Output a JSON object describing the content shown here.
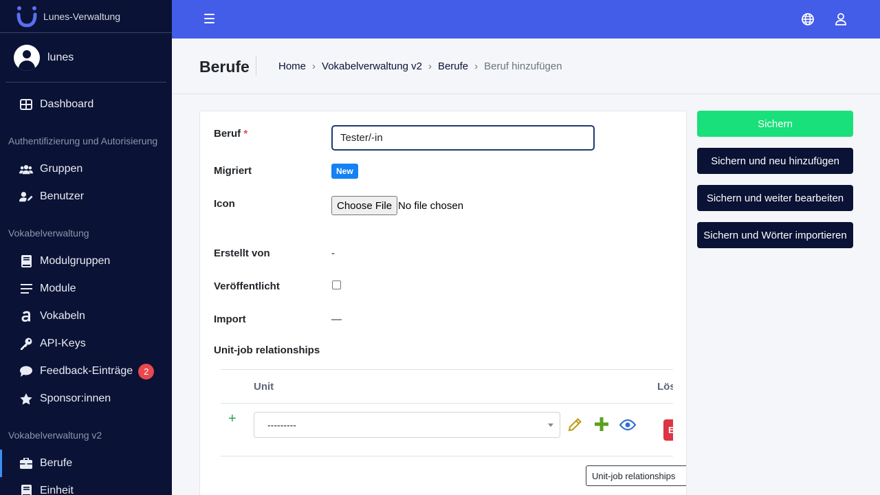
{
  "brand": {
    "name": "Lunes-Verwaltung"
  },
  "user": {
    "name": "lunes"
  },
  "sidebar": {
    "dashboard": "Dashboard",
    "sections": [
      {
        "header": "Authentifizierung und Autorisierung",
        "items": [
          "Gruppen",
          "Benutzer"
        ]
      },
      {
        "header": "Vokabelverwaltung",
        "items": [
          "Modulgruppen",
          "Module",
          "Vokabeln",
          "API-Keys",
          "Feedback-Einträge",
          "Sponsor:innen"
        ]
      },
      {
        "header": "Vokabelverwaltung v2",
        "items": [
          "Berufe",
          "Einheit"
        ]
      }
    ],
    "feedback_badge": "2",
    "active_item": "Berufe"
  },
  "header": {
    "page_title": "Berufe",
    "breadcrumb": [
      "Home",
      "Vokabelverwaltung v2",
      "Berufe",
      "Beruf hinzufügen"
    ]
  },
  "form": {
    "beruf": {
      "label": "Beruf",
      "required_mark": "*",
      "value": "Tester/-in"
    },
    "migriert": {
      "label": "Migriert",
      "badge": "New"
    },
    "icon": {
      "label": "Icon",
      "button": "Choose File",
      "status": "No file chosen"
    },
    "erstellt_von": {
      "label": "Erstellt von",
      "value": "-"
    },
    "veroeffentlicht": {
      "label": "Veröffentlicht",
      "checked": false
    },
    "import": {
      "label": "Import",
      "value": "—"
    },
    "relationships": {
      "label": "Unit-job relationships",
      "columns": {
        "unit": "Unit",
        "delete": "Lös"
      },
      "row": {
        "add": "+",
        "select_value": "---------",
        "delete_button": "E"
      },
      "add_button": "Unit-job relationships"
    }
  },
  "actions": {
    "save": "Sichern",
    "save_add": "Sichern und neu hinzufügen",
    "save_continue": "Sichern und weiter bearbeiten",
    "save_import": "Sichern und Wörter importieren"
  },
  "colors": {
    "sidebar_bg": "#0a1235",
    "topbar_bg": "#435de9",
    "success": "#19e07a",
    "danger": "#dc3545",
    "badge_blue": "#1482f4"
  }
}
